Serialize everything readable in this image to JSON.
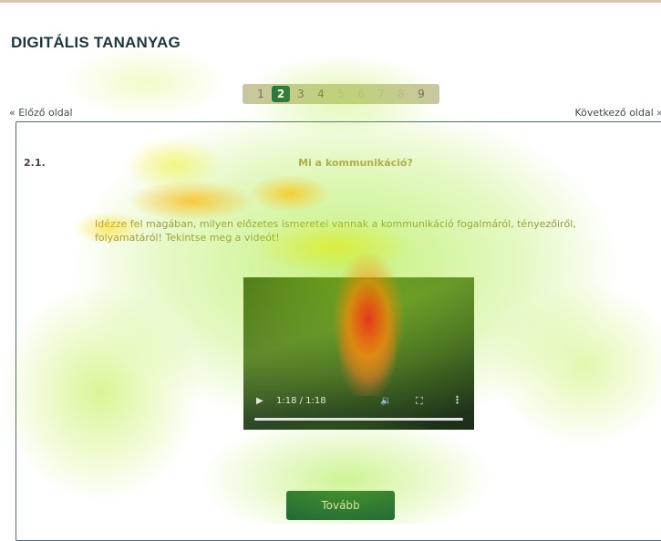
{
  "page": {
    "title": "DIGITÁLIS TANANYAG"
  },
  "pager": {
    "pages": [
      "1",
      "2",
      "3",
      "4",
      "5",
      "6",
      "7",
      "8",
      "9"
    ],
    "active": "2"
  },
  "nav": {
    "prev_label": "« Előző oldal",
    "next_label": "Következő oldal »"
  },
  "section": {
    "number": "2.1.",
    "title": "Mi a kommunikáció?",
    "text": "Idézze fel magában, milyen előzetes ismeretei vannak a kommunikáció fogalmáról, tényezőiről, folyamatáról! Tekintse meg a videót!"
  },
  "video": {
    "play_icon": "play-icon",
    "time": "1:18 / 1:18",
    "progress": 1.0,
    "volume_icon": "volume-icon",
    "fullscreen_icon": "fullscreen-icon",
    "more_icon": "more-vert-icon"
  },
  "actions": {
    "next_button": "Tovább"
  },
  "colors": {
    "title": "#1d3640",
    "active_page": "#1e6a3f",
    "button": "#125b3c",
    "border": "#4b6a7a"
  }
}
